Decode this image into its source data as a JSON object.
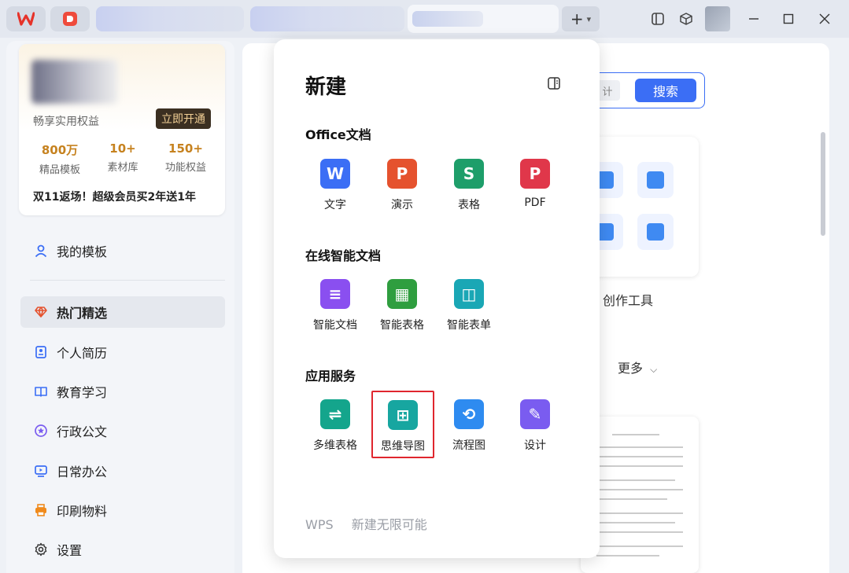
{
  "titlebar": {
    "logo_icon": "wps-logo-icon",
    "pdf_icon": "wps-pdf-icon",
    "new_tab_label": "+",
    "dropdown_icon": "chevron-down-icon",
    "window_controls": [
      "minimize",
      "maximize",
      "close"
    ]
  },
  "vip": {
    "subtitle": "畅享实用权益",
    "open_button": "立即开通",
    "stats": [
      {
        "value": "800万",
        "label": "精品模板"
      },
      {
        "value": "10+",
        "label": "素材库"
      },
      {
        "value": "150+",
        "label": "功能权益"
      }
    ],
    "promo": "双11返场！超级会员买2年送1年"
  },
  "sidebar": {
    "my_templates": "我的模板",
    "items": [
      {
        "label": "热门精选",
        "icon": "diamond-icon",
        "active": true
      },
      {
        "label": "个人简历",
        "icon": "resume-icon",
        "active": false
      },
      {
        "label": "教育学习",
        "icon": "book-icon",
        "active": false
      },
      {
        "label": "行政公文",
        "icon": "badge-icon",
        "active": false
      },
      {
        "label": "日常办公",
        "icon": "monitor-icon",
        "active": false
      },
      {
        "label": "印刷物料",
        "icon": "printer-icon",
        "active": false
      },
      {
        "label": "设置",
        "icon": "gear-icon",
        "active": false
      }
    ]
  },
  "content": {
    "search_tag": "计",
    "search_button": "搜索",
    "create_tools": "创作工具",
    "more": "更多"
  },
  "popup": {
    "title": "新建",
    "sections": [
      {
        "title": "Office文档",
        "apps": [
          {
            "label": "文字",
            "glyph": "W",
            "color": "#3b6ef5"
          },
          {
            "label": "演示",
            "glyph": "P",
            "color": "#e5522e"
          },
          {
            "label": "表格",
            "glyph": "S",
            "color": "#1e9e6a"
          },
          {
            "label": "PDF",
            "glyph": "P",
            "color": "#e0374a"
          }
        ]
      },
      {
        "title": "在线智能文档",
        "apps": [
          {
            "label": "智能文档",
            "glyph": "≡",
            "color": "#8a4ff0"
          },
          {
            "label": "智能表格",
            "glyph": "▦",
            "color": "#2f9e3f"
          },
          {
            "label": "智能表单",
            "glyph": "◫",
            "color": "#1aa7b5"
          }
        ]
      },
      {
        "title": "应用服务",
        "apps": [
          {
            "label": "多维表格",
            "glyph": "⇌",
            "color": "#14a58c"
          },
          {
            "label": "思维导图",
            "glyph": "⊞",
            "color": "#17a6a0",
            "selected": true
          },
          {
            "label": "流程图",
            "glyph": "⟲",
            "color": "#2e8bf0"
          },
          {
            "label": "设计",
            "glyph": "✎",
            "color": "#7a5cf0"
          }
        ]
      }
    ],
    "footer": [
      "WPS",
      "新建无限可能"
    ]
  }
}
